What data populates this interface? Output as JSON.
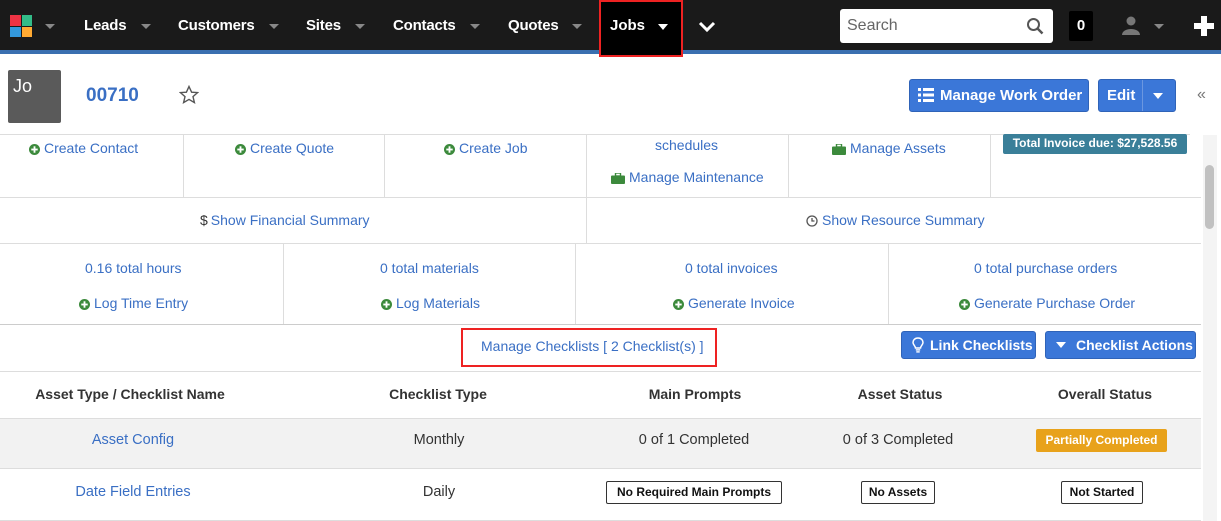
{
  "nav": {
    "items": [
      "Leads",
      "Customers",
      "Sites",
      "Contacts",
      "Quotes"
    ],
    "active": "Jobs",
    "search_placeholder": "Search",
    "notification_count": "0"
  },
  "header": {
    "avatar_initials": "Jo",
    "job_number": "00710",
    "manage_work_order_label": "Manage Work Order",
    "edit_label": "Edit",
    "collapse_label": "«"
  },
  "quick_links": {
    "create_contact": "Create Contact",
    "create_quote": "Create Quote",
    "create_job": "Create Job",
    "schedules": "schedules",
    "manage_maintenance": "Manage Maintenance",
    "manage_assets": "Manage Assets",
    "total_invoice_due": "Total Invoice due: $27,528.56",
    "show_financial_summary": "Show Financial Summary",
    "show_resource_summary": "Show Resource Summary"
  },
  "totals": [
    {
      "total": "0.16 total hours",
      "action": "Log Time Entry"
    },
    {
      "total": "0 total materials",
      "action": "Log Materials"
    },
    {
      "total": "0 total invoices",
      "action": "Generate Invoice"
    },
    {
      "total": "0 total purchase orders",
      "action": "Generate Purchase Order"
    }
  ],
  "checklists": {
    "manage_label": "Manage Checklists [ 2 Checklist(s) ]",
    "link_label": "Link Checklists",
    "actions_label": "Checklist Actions",
    "columns": [
      "Asset Type / Checklist Name",
      "Checklist Type",
      "Main Prompts",
      "Asset Status",
      "Overall Status"
    ],
    "rows": [
      {
        "name": "Asset Config",
        "type": "Monthly",
        "main_prompts": "0 of 1 Completed",
        "asset_status": "0 of 3 Completed",
        "overall_status": "Partially Completed"
      },
      {
        "name": "Date Field Entries",
        "type": "Daily",
        "main_prompts": "No Required Main Prompts",
        "asset_status": "No Assets",
        "overall_status": "Not Started"
      }
    ]
  },
  "colors": {
    "nav_bg": "#1a1a1a",
    "accent": "#3b77d8",
    "link": "#3a6fc4",
    "green_icon": "#3c8a3c",
    "warning": "#e8a21b",
    "highlight": "#e22222"
  }
}
